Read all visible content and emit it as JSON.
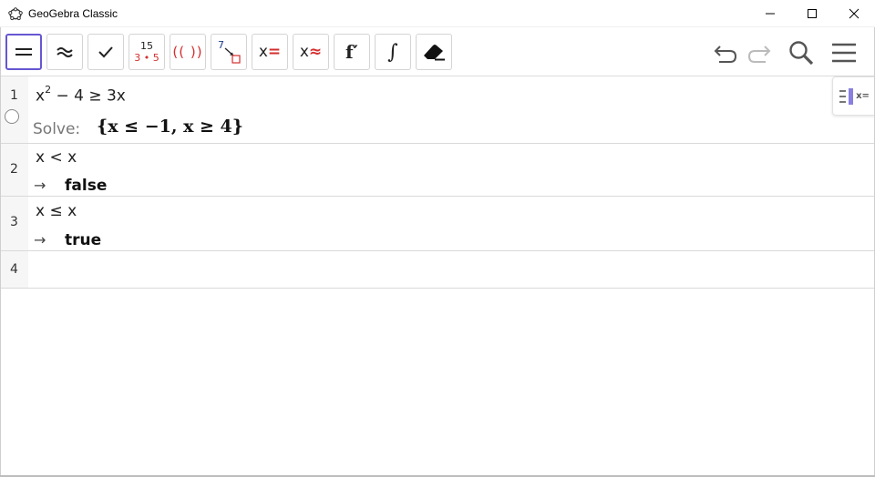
{
  "window": {
    "title": "GeoGebra Classic",
    "app_icon": "geogebra-pentagon-icon",
    "controls": [
      "minimize-icon",
      "maximize-icon",
      "close-icon"
    ]
  },
  "toolbar": {
    "tools": [
      {
        "name": "evaluate",
        "icon": "equals-icon",
        "selected": true
      },
      {
        "name": "numeric",
        "icon": "approx-icon"
      },
      {
        "name": "keep-input",
        "icon": "check-icon"
      },
      {
        "name": "factor",
        "icon": "factor-icon",
        "top_text": "15",
        "bottom_text": "3 • 5"
      },
      {
        "name": "expand",
        "icon": "expand-icon",
        "text": "(( ))"
      },
      {
        "name": "substitute",
        "icon": "substitute-icon",
        "text": "7"
      },
      {
        "name": "solve",
        "icon": "solve-icon",
        "text_x": "x",
        "text_op": "="
      },
      {
        "name": "solve-numerically",
        "icon": "nsolve-icon",
        "text_x": "x",
        "text_op": "≈"
      },
      {
        "name": "derivative",
        "icon": "derivative-icon",
        "text": "f′"
      },
      {
        "name": "integral",
        "icon": "integral-icon",
        "text": "∫"
      },
      {
        "name": "delete",
        "icon": "eraser-icon"
      }
    ],
    "right": [
      "undo-icon",
      "redo-icon",
      "search-icon",
      "menu-icon"
    ]
  },
  "rows": [
    {
      "number": "1",
      "input_base": "x",
      "input_exp": "2",
      "input_rest": " − 4 ≥  3x",
      "output_label": "Solve:",
      "output_value": "{x ≤ −1, x ≥ 4}"
    },
    {
      "number": "2",
      "input": "x < x",
      "arrow": "→",
      "output_value": "false"
    },
    {
      "number": "3",
      "input": "x ≤ x",
      "arrow": "→",
      "output_value": "true"
    },
    {
      "number": "4",
      "input": ""
    }
  ],
  "side_panel_toggle": {
    "icon": "algebra-view-toggle-icon",
    "text": "x="
  },
  "colors": {
    "accent": "#6557d2",
    "red": "#d32f2f",
    "blue": "#1e3a8a"
  }
}
